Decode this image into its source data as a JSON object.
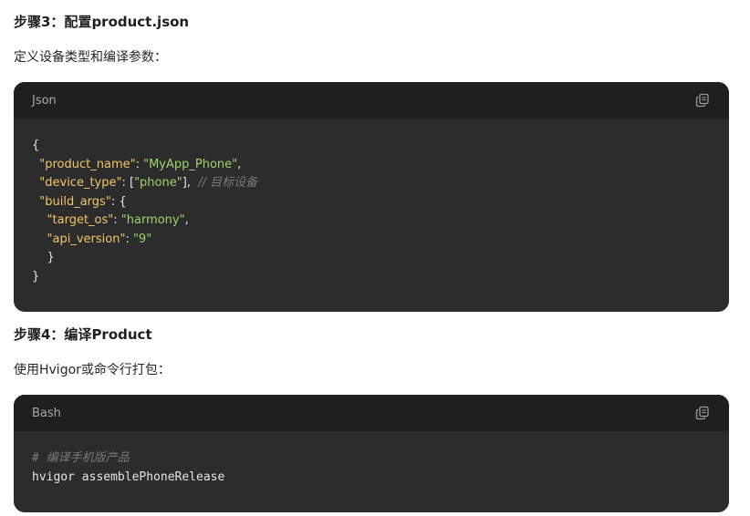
{
  "step3": {
    "heading": "步骤3：配置product.json",
    "description": "定义设备类型和编译参数：",
    "code_block": {
      "language": "Json",
      "copy_icon": "copy-icon",
      "lines": {
        "l1": "{",
        "l2_key": "\"product_name\"",
        "l2_sep": ": ",
        "l2_val": "\"MyApp_Phone\"",
        "l2_end": ",",
        "l3_key": "\"device_type\"",
        "l3_sep": ": [",
        "l3_val": "\"phone\"",
        "l3_end": "],",
        "l3_comment": "// 目标设备",
        "l4_key": "\"build_args\"",
        "l4_end": ": {",
        "l5_key": "\"target_os\"",
        "l5_sep": ": ",
        "l5_val": "\"harmony\"",
        "l5_end": ",",
        "l6_key": "\"api_version\"",
        "l6_sep": ": ",
        "l6_val": "\"9\"",
        "l7": "}",
        "l8": "}"
      }
    }
  },
  "step4": {
    "heading": "步骤4：编译Product",
    "description": "使用Hvigor或命令行打包：",
    "code_block": {
      "language": "Bash",
      "copy_icon": "copy-icon",
      "comment": "# 编译手机版产品",
      "command": "hvigor assemblePhoneRelease"
    }
  },
  "colors": {
    "code_bg": "#2c2c2c",
    "code_header_bg": "#1f1f1f",
    "json_key": "#f2c56b",
    "json_string": "#9fd36b",
    "comment": "#7a7a7a"
  }
}
